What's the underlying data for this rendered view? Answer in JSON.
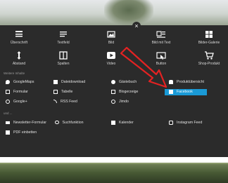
{
  "widgets_row1": [
    {
      "label": "Überschrift",
      "icon": "heading-icon"
    },
    {
      "label": "Textfeld",
      "icon": "text-icon"
    },
    {
      "label": "Bild",
      "icon": "image-icon"
    },
    {
      "label": "Bild mit Text",
      "icon": "image-text-icon"
    },
    {
      "label": "Bilder-Galerie",
      "icon": "gallery-icon"
    }
  ],
  "widgets_row2": [
    {
      "label": "Abstand",
      "icon": "spacing-icon"
    },
    {
      "label": "Spalten",
      "icon": "columns-icon"
    },
    {
      "label": "Video",
      "icon": "video-icon"
    },
    {
      "label": "Button",
      "icon": "button-icon"
    },
    {
      "label": "Shop-Produkt",
      "icon": "cart-icon"
    }
  ],
  "section_more": "Weitere Inhalte",
  "section_other": "und ...",
  "close": "×",
  "items": {
    "google_maps": "GoogleMaps",
    "datei_download": "Dateidownload",
    "gaestebuch": "Gästebuch",
    "produktuebersicht": "Produktübersicht",
    "formular": "Formular",
    "tabelle": "Tabelle",
    "blogerzeige": "Blogerzeige",
    "facebook": "Facebook",
    "google_plus": "Google+",
    "rss_feed": "RSS Feed",
    "jimdo": "Jimdo",
    "newsletter": "Newsletter-Formular",
    "suchfunktion": "Suchfunktion",
    "kalender": "Kalender",
    "instagram": "Instagram Feed",
    "pdf": "PDF einbetten"
  }
}
